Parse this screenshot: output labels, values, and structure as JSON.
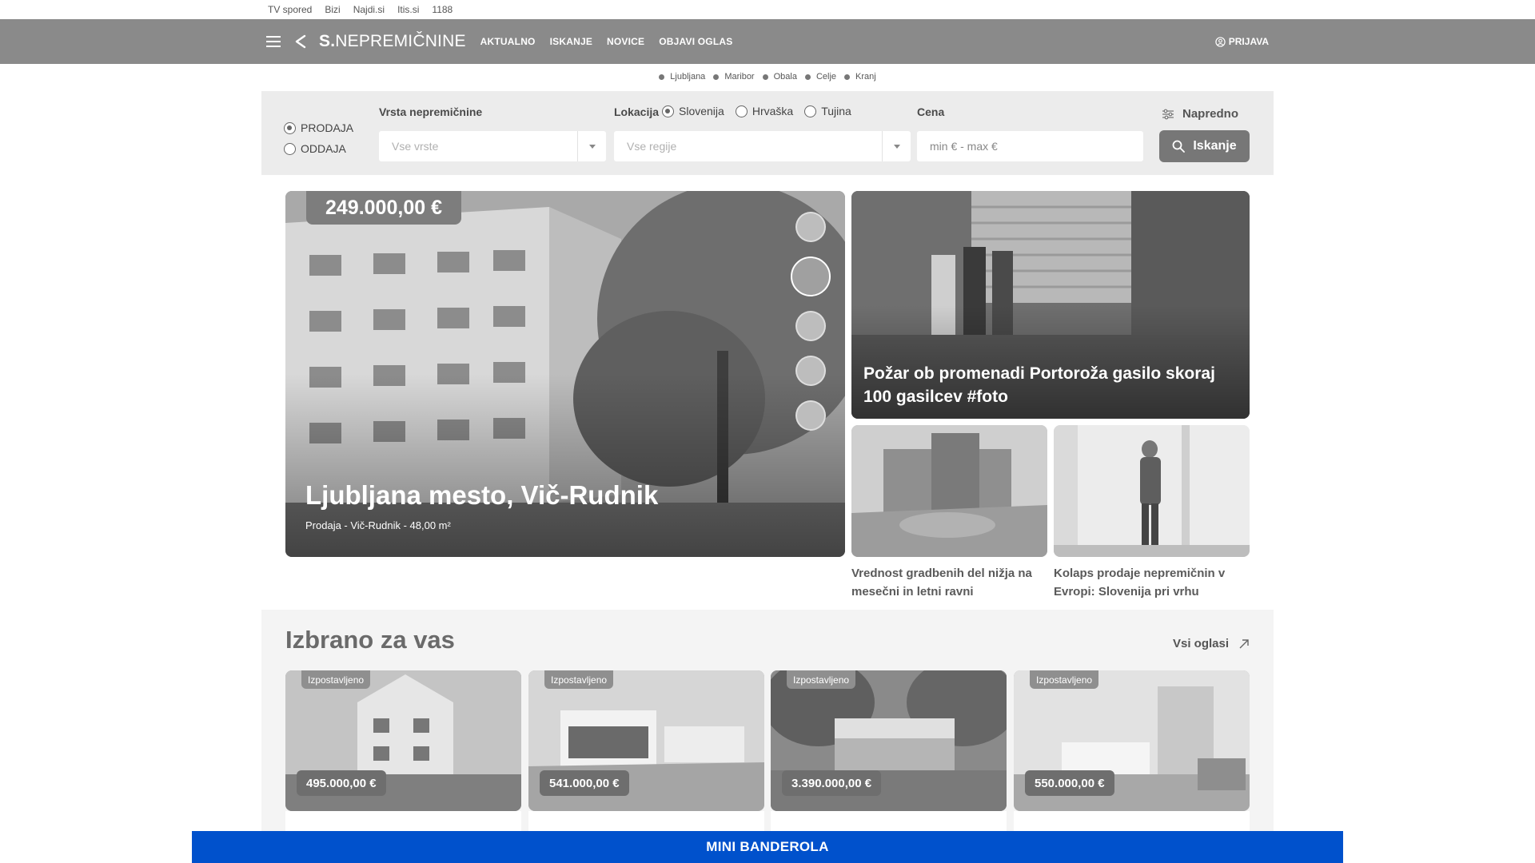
{
  "util_links": [
    "TV spored",
    "Bizi",
    "Najdi.si",
    "Itis.si",
    "1188"
  ],
  "header": {
    "logo_bold": "S.",
    "logo_text": "NEPREMIČNINE",
    "nav": [
      "AKTUALNO",
      "ISKANJE",
      "NOVICE",
      "OBJAVI OGLAS"
    ],
    "login": "PRIJAVA"
  },
  "cities": [
    "Ljubljana",
    "Maribor",
    "Obala",
    "Celje",
    "Kranj"
  ],
  "search": {
    "deal_options": [
      {
        "label": "PRODAJA",
        "selected": true
      },
      {
        "label": "ODDAJA",
        "selected": false
      }
    ],
    "type_label": "Vrsta nepremičnine",
    "type_placeholder": "Vse vrste",
    "location_label": "Lokacija",
    "location_options": [
      {
        "label": "Slovenija",
        "selected": true
      },
      {
        "label": "Hrvaška",
        "selected": false
      },
      {
        "label": "Tujina",
        "selected": false
      }
    ],
    "region_placeholder": "Vse regije",
    "price_label": "Cena",
    "price_placeholder": "min € - max €",
    "advanced_label": "Napredno",
    "search_button": "Iskanje"
  },
  "hero": {
    "price": "249.000,00 €",
    "title": "Ljubljana mesto, Vič-Rudnik",
    "subtitle": "Prodaja - Vič-Rudnik - 48,00 m²",
    "thumbnail_count": 5,
    "active_thumbnail": 2
  },
  "news": {
    "main_title": "Požar ob promenadi Portoroža gasilo skoraj 100 gasilcev #foto",
    "small": [
      {
        "title": "Vrednost gradbenih del nižja na mesečni in letni ravni"
      },
      {
        "title": "Kolaps prodaje nepremičnin v Evropi: Slovenija pri vrhu"
      }
    ]
  },
  "featured": {
    "title": "Izbrano za vas",
    "all_link": "Vsi oglasi",
    "cards": [
      {
        "badge": "Izpostavljeno",
        "price": "495.000,00 €"
      },
      {
        "badge": "Izpostavljeno",
        "price": "541.000,00 €"
      },
      {
        "badge": "Izpostavljeno",
        "price": "3.390.000,00 €"
      },
      {
        "badge": "Izpostavljeno",
        "price": "550.000,00 €"
      }
    ]
  },
  "banner": "MINI BANDEROLA",
  "colors": {
    "header_bg": "#8a8a8a",
    "banner_bg": "#0051cc",
    "panel_bg": "#ececec"
  }
}
